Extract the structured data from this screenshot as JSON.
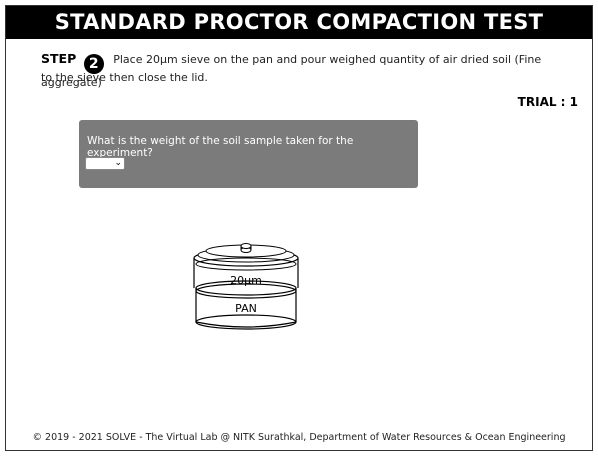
{
  "header": {
    "title": "STANDARD PROCTOR COMPACTION TEST"
  },
  "step": {
    "label": "STEP",
    "number": "2",
    "instruction_line1": "Place 20µm sieve on the pan and pour weighed quantity of air dried soil (Fine aggregate)",
    "instruction_line2": "to the sieve then close the lid."
  },
  "trial": {
    "label": "TRIAL : 1"
  },
  "question": {
    "text": "What is the weight of the soil sample taken for the experiment?",
    "select_value": ""
  },
  "apparatus": {
    "sieve_label": "20µm",
    "pan_label": "PAN"
  },
  "footer": {
    "text": "© 2019 - 2021 SOLVE - The Virtual Lab @ NITK Surathkal, Department of Water Resources & Ocean Engineering"
  }
}
